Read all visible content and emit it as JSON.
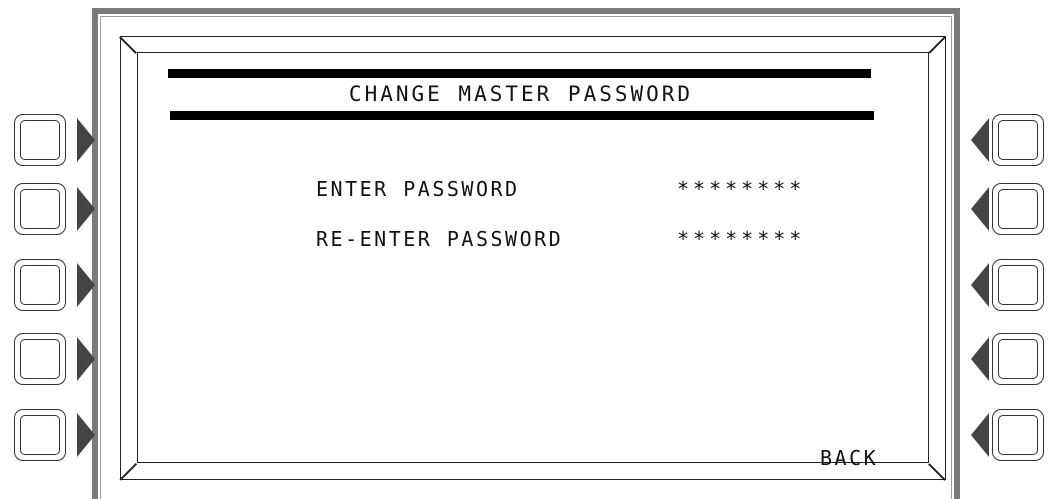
{
  "screen": {
    "title": "CHANGE MASTER PASSWORD",
    "fields": [
      {
        "label": "ENTER PASSWORD",
        "value": "********"
      },
      {
        "label": "RE-ENTER PASSWORD",
        "value": "********"
      }
    ],
    "back_label": "BACK"
  },
  "softkeys": {
    "left_count": 5,
    "right_count": 5
  }
}
